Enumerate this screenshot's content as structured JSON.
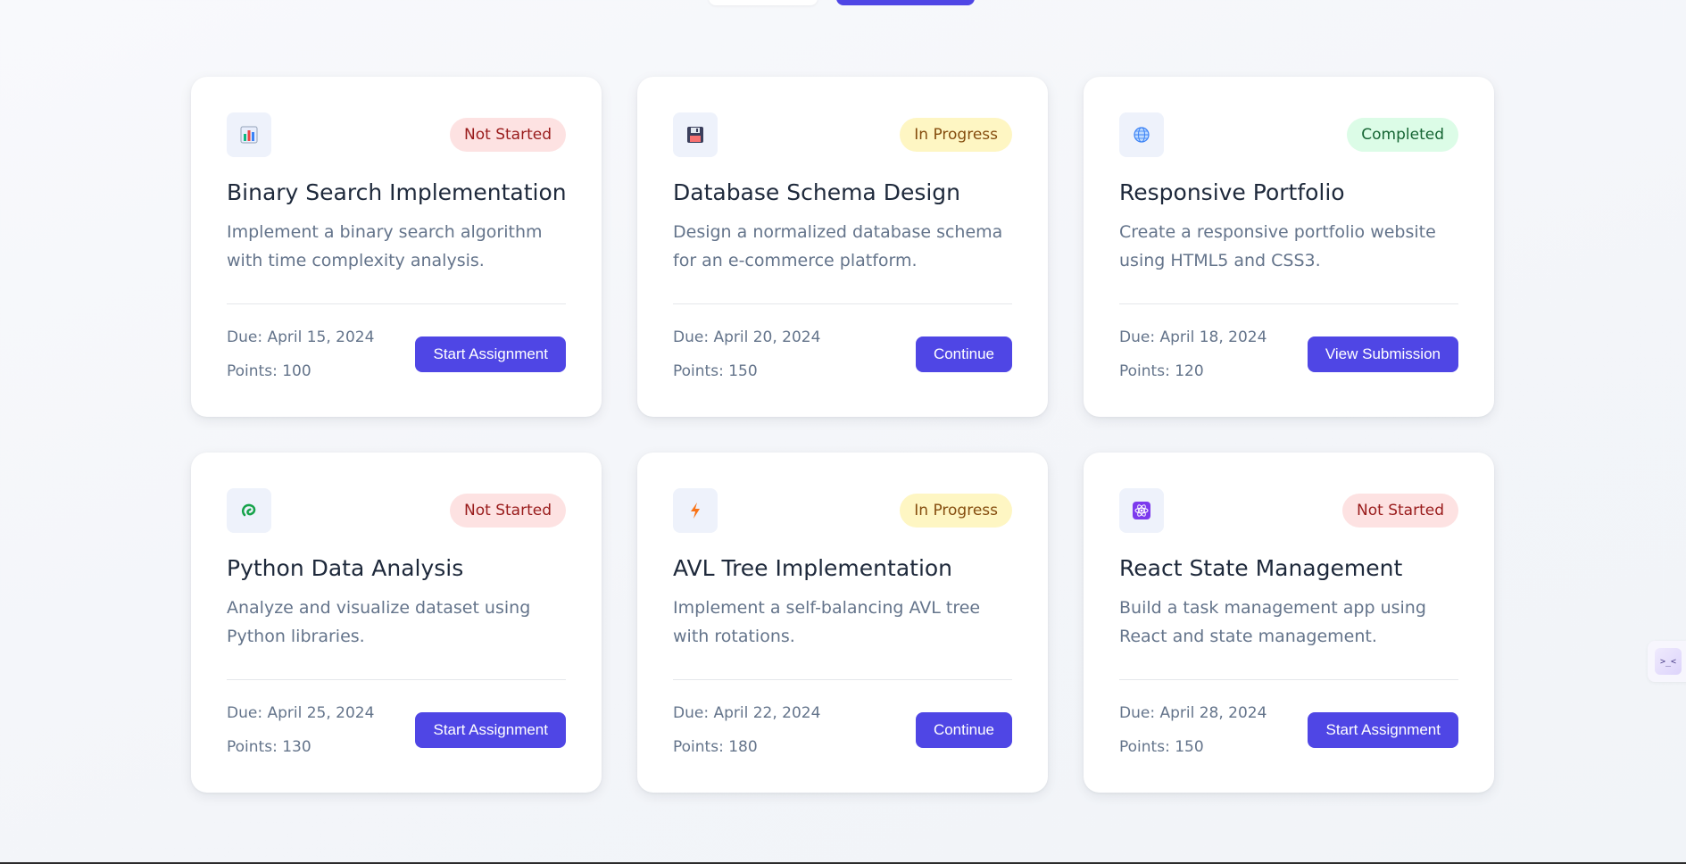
{
  "colors": {
    "accent": "#4f46e5",
    "not_started_bg": "#fde2e2",
    "in_progress_bg": "#fef6c3",
    "completed_bg": "#dcfce7"
  },
  "assignments": [
    {
      "icon": "bar-chart-icon",
      "status": "Not Started",
      "title": "Binary Search Implementation",
      "description": "Implement a binary search algorithm with time complexity analysis.",
      "due": "Due: April 15, 2024",
      "points": "Points: 100",
      "action": "Start Assignment"
    },
    {
      "icon": "floppy-disk-icon",
      "status": "In Progress",
      "title": "Database Schema Design",
      "description": "Design a normalized database schema for an e-commerce platform.",
      "due": "Due: April 20, 2024",
      "points": "Points: 150",
      "action": "Continue"
    },
    {
      "icon": "globe-icon",
      "status": "Completed",
      "title": "Responsive Portfolio",
      "description": "Create a responsive portfolio website using HTML5 and CSS3.",
      "due": "Due: April 18, 2024",
      "points": "Points: 120",
      "action": "View Submission"
    },
    {
      "icon": "snake-icon",
      "status": "Not Started",
      "title": "Python Data Analysis",
      "description": "Analyze and visualize dataset using Python libraries.",
      "due": "Due: April 25, 2024",
      "points": "Points: 130",
      "action": "Start Assignment"
    },
    {
      "icon": "lightning-icon",
      "status": "In Progress",
      "title": "AVL Tree Implementation",
      "description": "Implement a self-balancing AVL tree with rotations.",
      "due": "Due: April 22, 2024",
      "points": "Points: 180",
      "action": "Continue"
    },
    {
      "icon": "atom-icon",
      "status": "Not Started",
      "title": "React State Management",
      "description": "Build a task management app using React and state management.",
      "due": "Due: April 28, 2024",
      "points": "Points: 150",
      "action": "Start Assignment"
    }
  ],
  "side_widget": {
    "icon": "terminal-icon",
    "label": ">_<"
  }
}
